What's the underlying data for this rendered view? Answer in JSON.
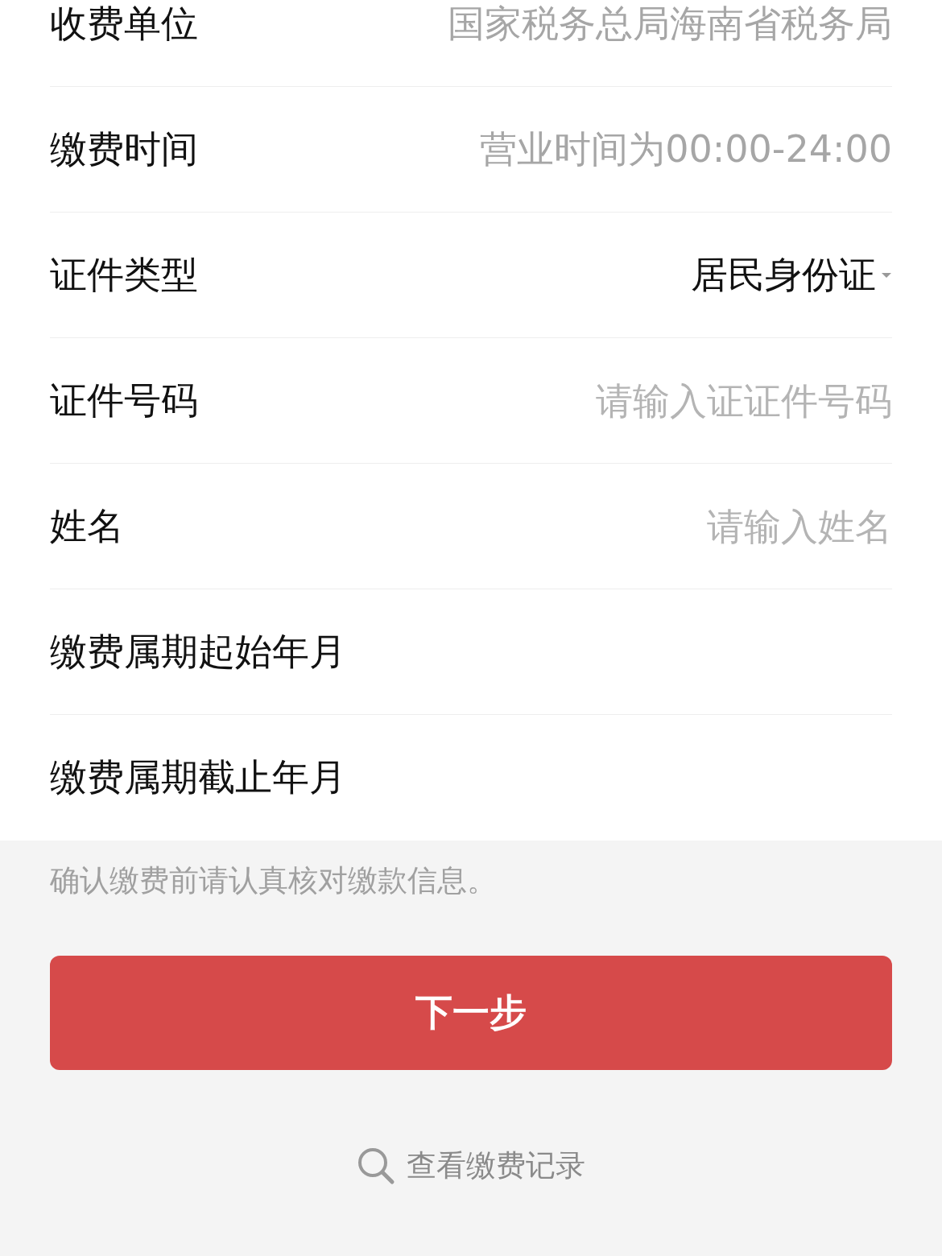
{
  "rows": [
    {
      "kind": "text",
      "label": "收费单位",
      "value": "国家税务总局海南省税务局"
    },
    {
      "kind": "text",
      "label": "缴费时间",
      "value": "营业时间为00:00-24:00"
    },
    {
      "kind": "select",
      "label": "证件类型",
      "value": "居民身份证"
    },
    {
      "kind": "input",
      "label": "证件号码",
      "placeholder": "请输入证证件号码"
    },
    {
      "kind": "input",
      "label": "姓名",
      "placeholder": "请输入姓名"
    },
    {
      "kind": "empty",
      "label": "缴费属期起始年月"
    },
    {
      "kind": "empty",
      "label": "缴费属期截止年月"
    }
  ],
  "notice": "确认缴费前请认真核对缴款信息。",
  "next_button": "下一步",
  "history_link": "查看缴费记录"
}
